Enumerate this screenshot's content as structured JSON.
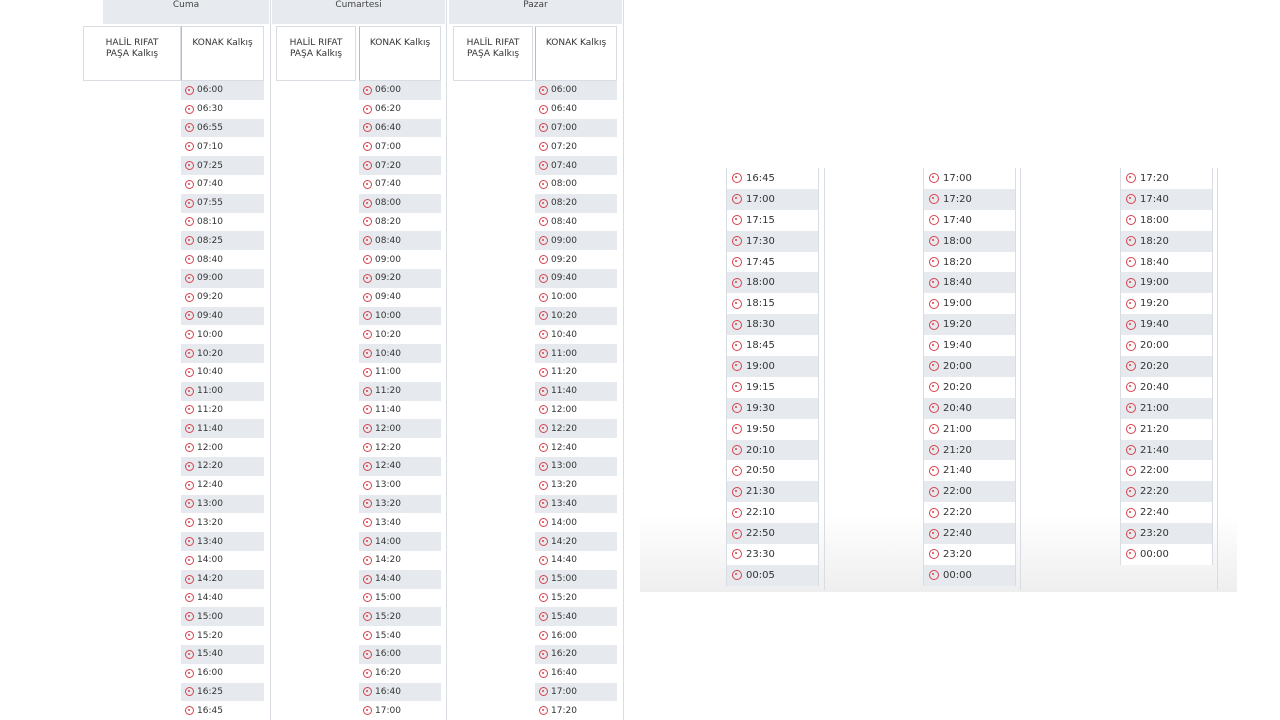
{
  "left_schedule": {
    "days": [
      {
        "day": "Cuma",
        "col1": "HALİL RIFAT\nPAŞA Kalkış",
        "col2": "KONAK Kalkış",
        "times": [
          "06:00",
          "06:30",
          "06:55",
          "07:10",
          "07:25",
          "07:40",
          "07:55",
          "08:10",
          "08:25",
          "08:40",
          "09:00",
          "09:20",
          "09:40",
          "10:00",
          "10:20",
          "10:40",
          "11:00",
          "11:20",
          "11:40",
          "12:00",
          "12:20",
          "12:40",
          "13:00",
          "13:20",
          "13:40",
          "14:00",
          "14:20",
          "14:40",
          "15:00",
          "15:20",
          "15:40",
          "16:00",
          "16:25",
          "16:45"
        ]
      },
      {
        "day": "Cumartesi",
        "col1": "HALİL RIFAT\nPAŞA Kalkış",
        "col2": "KONAK Kalkış",
        "times": [
          "06:00",
          "06:20",
          "06:40",
          "07:00",
          "07:20",
          "07:40",
          "08:00",
          "08:20",
          "08:40",
          "09:00",
          "09:20",
          "09:40",
          "10:00",
          "10:20",
          "10:40",
          "11:00",
          "11:20",
          "11:40",
          "12:00",
          "12:20",
          "12:40",
          "13:00",
          "13:20",
          "13:40",
          "14:00",
          "14:20",
          "14:40",
          "15:00",
          "15:20",
          "15:40",
          "16:00",
          "16:20",
          "16:40",
          "17:00"
        ]
      },
      {
        "day": "Pazar",
        "col1": "HALİL RIFAT\nPAŞA Kalkış",
        "col2": "KONAK Kalkış",
        "times": [
          "06:00",
          "06:40",
          "07:00",
          "07:20",
          "07:40",
          "08:00",
          "08:20",
          "08:40",
          "09:00",
          "09:20",
          "09:40",
          "10:00",
          "10:20",
          "10:40",
          "11:00",
          "11:20",
          "11:40",
          "12:00",
          "12:20",
          "12:40",
          "13:00",
          "13:20",
          "13:40",
          "14:00",
          "14:20",
          "14:40",
          "15:00",
          "15:20",
          "15:40",
          "16:00",
          "16:20",
          "16:40",
          "17:00",
          "17:20"
        ]
      }
    ]
  },
  "right_schedule": {
    "columns": [
      {
        "times": [
          "16:45",
          "17:00",
          "17:15",
          "17:30",
          "17:45",
          "18:00",
          "18:15",
          "18:30",
          "18:45",
          "19:00",
          "19:15",
          "19:30",
          "19:50",
          "20:10",
          "20:50",
          "21:30",
          "22:10",
          "22:50",
          "23:30",
          "00:05"
        ]
      },
      {
        "times": [
          "17:00",
          "17:20",
          "17:40",
          "18:00",
          "18:20",
          "18:40",
          "19:00",
          "19:20",
          "19:40",
          "20:00",
          "20:20",
          "20:40",
          "21:00",
          "21:20",
          "21:40",
          "22:00",
          "22:20",
          "22:40",
          "23:20",
          "00:00"
        ]
      },
      {
        "times": [
          "17:20",
          "17:40",
          "18:00",
          "18:20",
          "18:40",
          "19:00",
          "19:20",
          "19:40",
          "20:00",
          "20:20",
          "20:40",
          "21:00",
          "21:20",
          "21:40",
          "22:00",
          "22:20",
          "22:40",
          "23:20",
          "00:00"
        ]
      }
    ]
  },
  "colors": {
    "icon": "#d8414c",
    "stripe": "#e6eaee",
    "header": "#e7eaee"
  },
  "icon_name": "ferry-icon"
}
